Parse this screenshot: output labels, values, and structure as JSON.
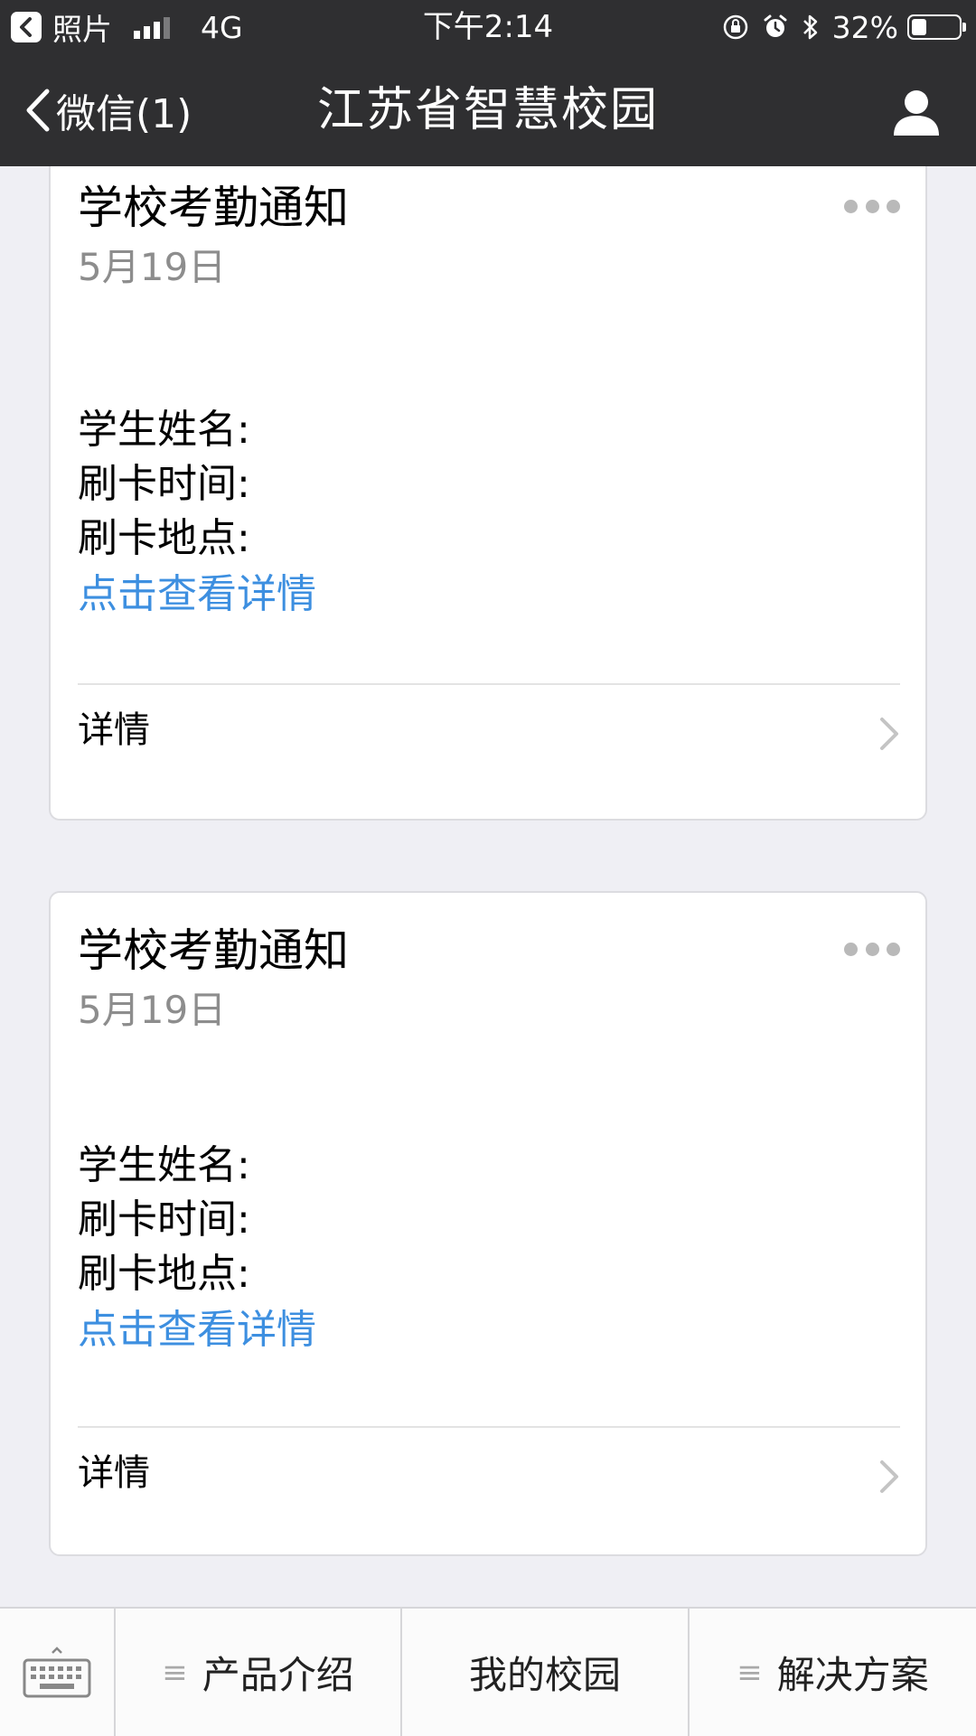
{
  "status_bar": {
    "back_app": "照片",
    "network": "4G",
    "time": "下午2:14",
    "battery": "32%",
    "battery_level": 0.32,
    "signal_bars_filled": 3,
    "signal_bars_total": 4
  },
  "nav": {
    "back_label": "微信(1)",
    "title": "江苏省智慧校园"
  },
  "cards": [
    {
      "title": "学校考勤通知",
      "date": "5月19日",
      "fields": [
        "学生姓名:",
        "刷卡时间:",
        "刷卡地点:"
      ],
      "link": "点击查看详情",
      "detail": "详情"
    },
    {
      "title": "学校考勤通知",
      "date": "5月19日",
      "fields": [
        "学生姓名:",
        "刷卡时间:",
        "刷卡地点:"
      ],
      "link": "点击查看详情",
      "detail": "详情"
    }
  ],
  "bottom_menu": {
    "items": [
      {
        "label": "产品介绍",
        "icon": "≡"
      },
      {
        "label": "我的校园",
        "icon": ""
      },
      {
        "label": "解决方案",
        "icon": "≡"
      }
    ]
  },
  "colors": {
    "bar_background": "#2f2f31",
    "page_background": "#efeff4",
    "link": "#3d8fe0",
    "date": "#8d8d8d"
  }
}
